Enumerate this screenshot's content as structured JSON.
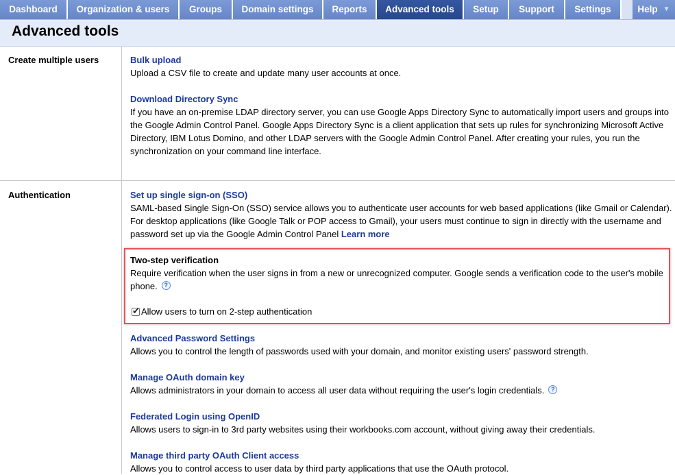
{
  "nav": {
    "tabs": [
      {
        "label": "Dashboard"
      },
      {
        "label": "Organization & users"
      },
      {
        "label": "Groups"
      },
      {
        "label": "Domain settings"
      },
      {
        "label": "Reports"
      },
      {
        "label": "Advanced tools"
      },
      {
        "label": "Setup"
      },
      {
        "label": "Support"
      },
      {
        "label": "Settings"
      },
      {
        "label": "Help"
      }
    ],
    "active_tab": "Advanced tools",
    "colors": {
      "tab": "#6f8fcf",
      "active_tab": "#2d4f9b",
      "link": "#1c3a9c",
      "highlight": "#e0555a"
    }
  },
  "page": {
    "title": "Advanced tools"
  },
  "sections": {
    "create_users": {
      "label": "Create multiple users",
      "bulk_upload": {
        "title": "Bulk upload",
        "desc": "Upload a CSV file to create and update many user accounts at once."
      },
      "directory_sync": {
        "title": "Download Directory Sync",
        "lines": [
          "If you have an on-premise LDAP directory server, you can use Google Apps Directory Sync to automatically import users and groups into",
          "the Google Admin Control Panel. Google Apps Directory Sync is a client application that sets up rules for synchronizing Microsoft Active",
          "Directory, IBM Lotus Domino, and other LDAP servers with the Google Admin Control Panel. After creating your rules, you run the",
          "synchronization on your command line interface."
        ]
      }
    },
    "authentication": {
      "label": "Authentication",
      "sso": {
        "title": "Set up single sign-on (SSO)",
        "lines": [
          "SAML-based Single Sign-On (SSO) service allows you to authenticate user accounts for web based applications (like Gmail or Calendar).",
          "For desktop applications (like Google Talk or POP access to Gmail), your users must continue to sign in directly with the username and",
          "password set up via the Google Admin Control Panel"
        ],
        "learn_more": "Learn more"
      },
      "two_step": {
        "title": "Two-step verification",
        "lines": [
          "Require verification when the user signs in from a new or unrecognized computer. Google sends a verification code to the user's mobile",
          "phone."
        ],
        "checkbox_label": "Allow users to turn on 2-step authentication",
        "checkbox_checked": true
      },
      "password": {
        "title": "Advanced Password Settings",
        "desc": "Allows you to control the length of passwords used with your domain, and monitor existing users' password strength."
      },
      "oauth_key": {
        "title": "Manage OAuth domain key",
        "desc": "Allows administrators in your domain to access all user data without requiring the user's login credentials."
      },
      "openid": {
        "title": "Federated Login using OpenID",
        "desc": "Allows users to sign-in to 3rd party websites using their workbooks.com account, without giving away their credentials."
      },
      "oauth_client": {
        "title": "Manage third party OAuth Client access",
        "desc": "Allows you to control access to user data by third party applications that use the OAuth protocol."
      }
    }
  }
}
